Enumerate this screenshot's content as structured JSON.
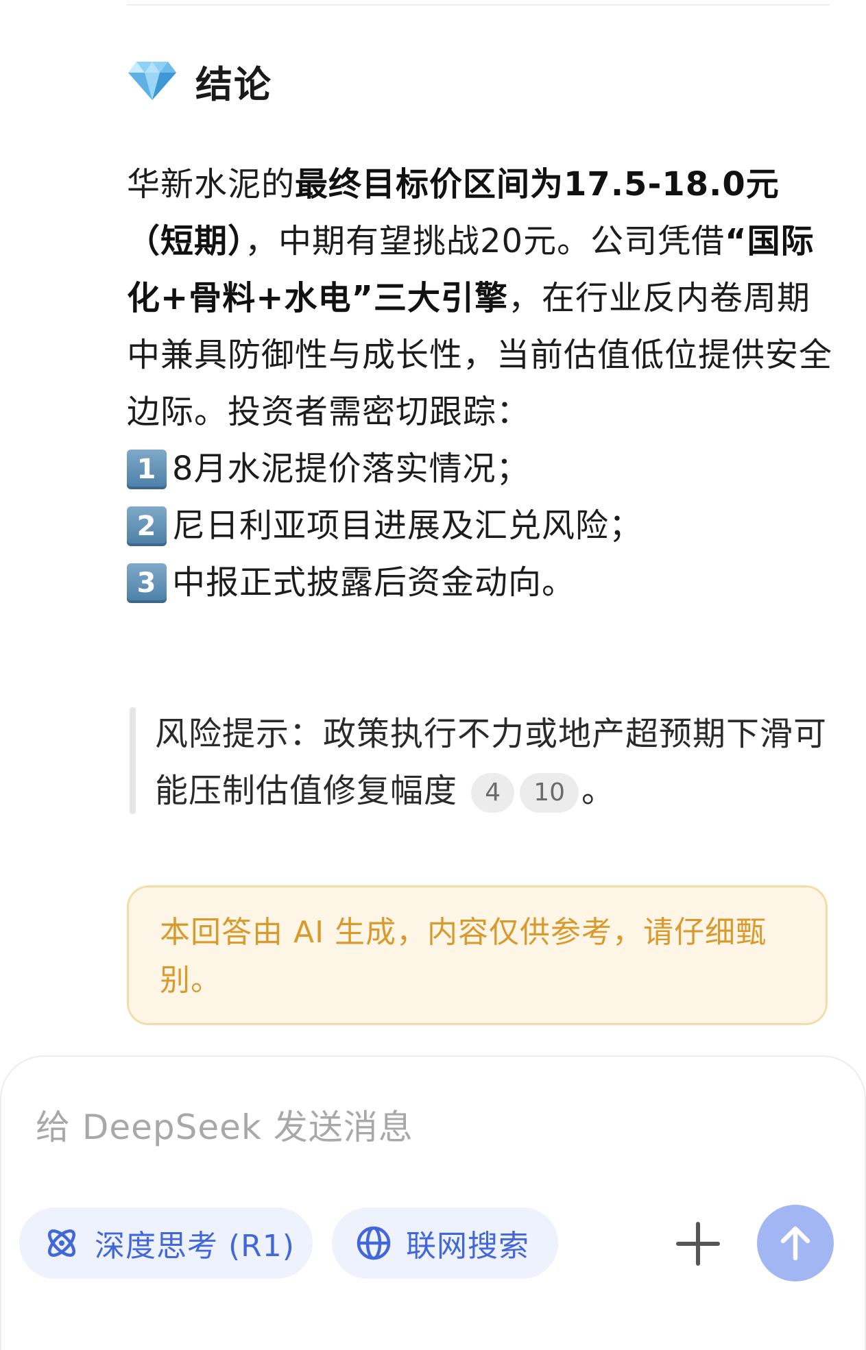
{
  "section": {
    "title": "结论"
  },
  "conclusion": {
    "p1": "华新水泥的",
    "p1_bold": "最终目标价区间为17.5-18.0元（短期）",
    "p2": "，中期有望挑战20元。公司凭借",
    "p2_bold": "“国际化+骨料+水电”三大引擎",
    "p3": "，在行业反内卷周期中兼具防御性与成长性，当前估值低位提供安全边际。投资者需密切跟踪：",
    "items": [
      {
        "num": "1",
        "text": "8月水泥提价落实情况；"
      },
      {
        "num": "2",
        "text": "尼日利亚项目进展及汇兑风险；"
      },
      {
        "num": "3",
        "text": "中报正式披露后资金动向。"
      }
    ]
  },
  "risk": {
    "text": "风险提示：政策执行不力或地产超预期下滑可能压制估值修复幅度",
    "citations": [
      "4",
      "10"
    ],
    "end": "。"
  },
  "disclaimer": {
    "text": "本回答由 AI 生成，内容仅供参考，请仔细甄别。"
  },
  "composer": {
    "placeholder": "给 DeepSeek 发送消息",
    "deep_think_label": "深度思考 (R1)",
    "web_search_label": "联网搜索"
  },
  "colors": {
    "accent_blue": "#4267d8",
    "pill_bg": "#eef2fd",
    "send_button": "#a3b6f4",
    "disclaimer_text": "#d99a2d",
    "disclaimer_bg": "#fdf6e6"
  },
  "icons": {
    "section": "gem-icon",
    "deep_think": "atom-icon",
    "web_search": "globe-icon",
    "attach": "plus-icon",
    "send": "arrow-up-icon"
  }
}
